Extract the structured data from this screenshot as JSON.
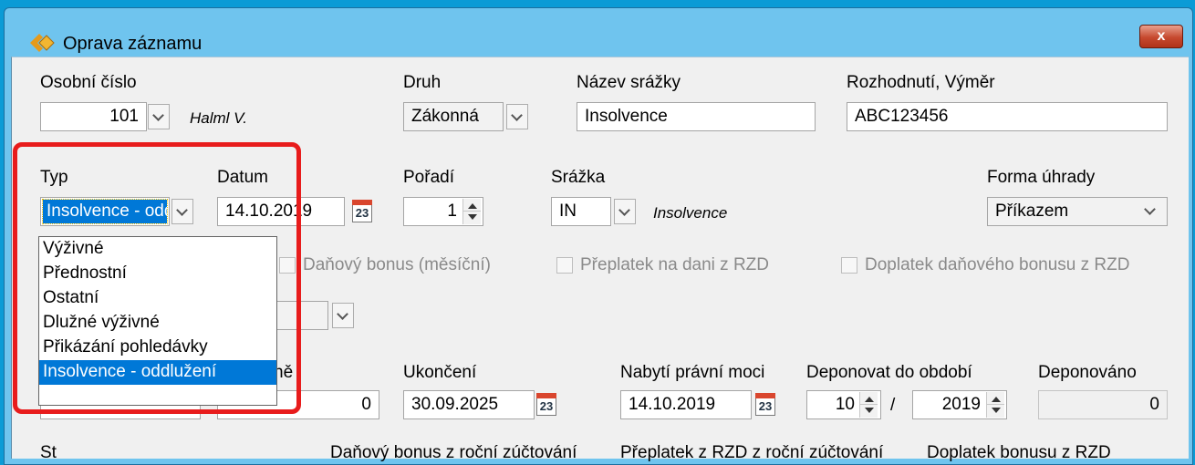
{
  "window": {
    "title": "Oprava záznamu",
    "close_label": "x"
  },
  "labels": {
    "osobni_cislo": "Osobní číslo",
    "druh": "Druh",
    "nazev_srazky": "Název srážky",
    "rozhodnuti": "Rozhodnutí, Výměr",
    "typ": "Typ",
    "datum": "Datum",
    "poradi": "Pořadí",
    "srazka": "Srážka",
    "forma_uhrady": "Forma úhrady",
    "partial_label": "ně",
    "ukonceni": "Ukončení",
    "nabyti": "Nabytí právní moci",
    "deponovat": "Deponovat do období",
    "deponovano": "Deponováno"
  },
  "fields": {
    "osobni_cislo_value": "101",
    "employee_name": "Halml V.",
    "druh_value": "Zákonná",
    "nazev_srazky_value": "Insolvence",
    "rozhodnuti_value": "ABC123456",
    "typ_value": "Insolvence - oddlužení",
    "datum_value": "14.10.2019",
    "poradi_value": "1",
    "srazka_code": "IN",
    "srazka_name": "Insolvence",
    "forma_uhrady_value": "Příkazem",
    "partial_amount_value": "0",
    "ukonceni_value": "30.09.2025",
    "nabyti_value": "14.10.2019",
    "deponovat_month": "10",
    "deponovat_separator": "/",
    "deponovat_year": "2019",
    "deponovano_value": "0",
    "calendar_day": "23"
  },
  "checkboxes": {
    "danovy_bonus": "Daňový bonus (měsíční)",
    "preplatek": "Přeplatek na dani z RZD",
    "doplatek": "Doplatek daňového bonusu z RZD"
  },
  "typ_dropdown": {
    "options": [
      "Výživné",
      "Přednostní",
      "Ostatní",
      "Dlužné výživné",
      "Přikázání pohledávky",
      "Insolvence - oddlužení"
    ],
    "selected": "Insolvence - oddlužení"
  },
  "bottom_row_partial": {
    "left": "St",
    "middle": "Daňový bonus z roční zúčtování",
    "right_a": "Přeplatek z RZD z roční zúčtování",
    "right_b": "Doplatek bonusu z RZD"
  },
  "colors": {
    "selection": "#0078d7",
    "highlight_box": "#e81c1c",
    "window_frame": "#6fc4ee"
  }
}
